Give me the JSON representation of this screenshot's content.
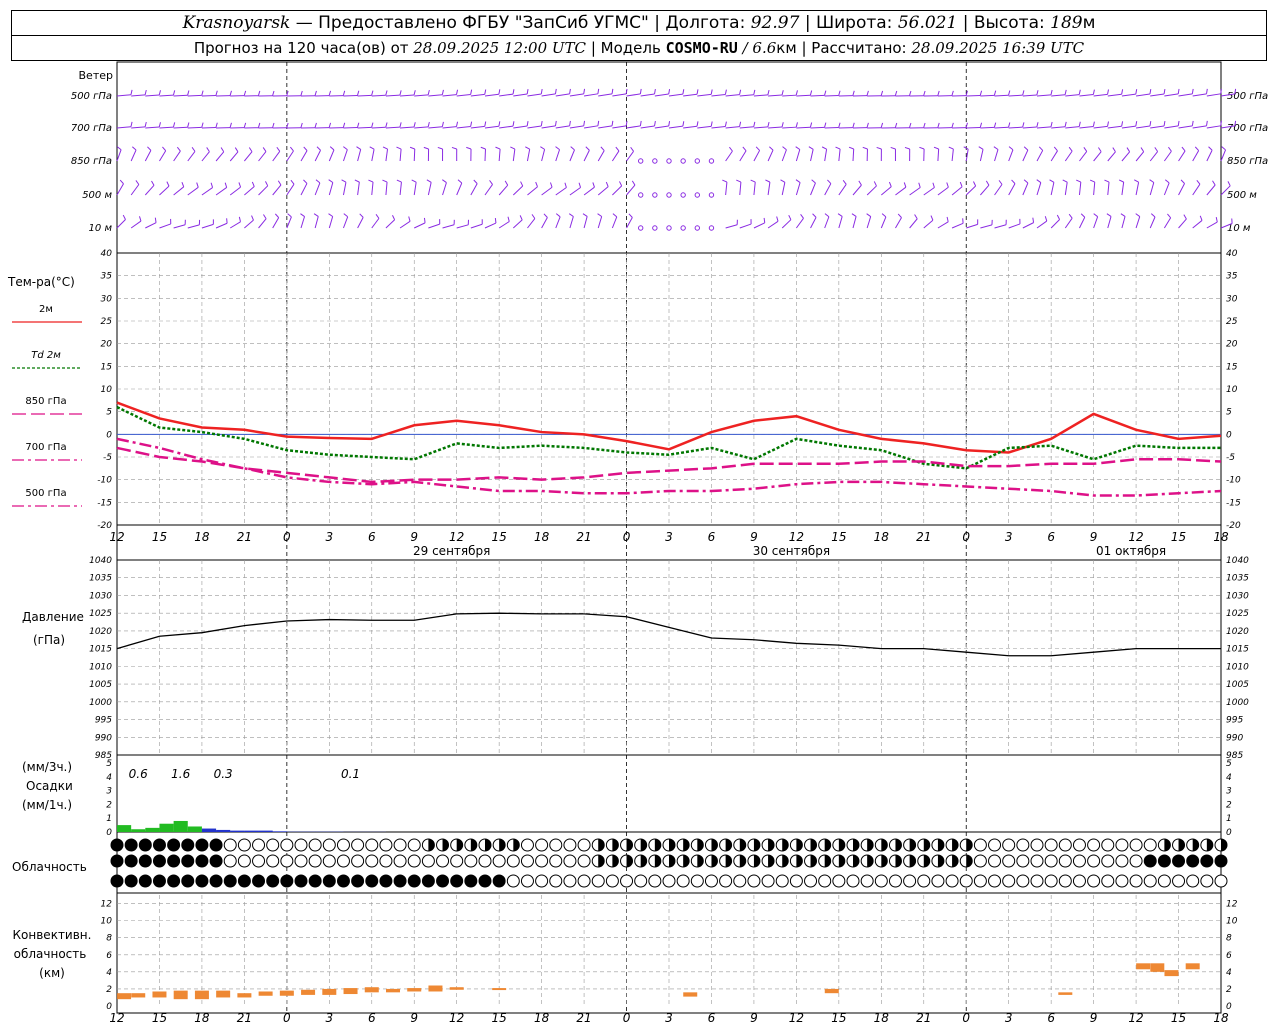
{
  "header": {
    "city": "Krasnoyarsk",
    "provider": "— Предоставлено ФГБУ \"ЗапСиб УГМС\" |",
    "lon_label": "Долгота:",
    "lon": "92.97",
    "lat_label": "| Широта:",
    "lat": "56.021",
    "alt_label": "| Высота:",
    "alt": "189",
    "alt_unit": "м",
    "forecast_prefix": "Прогноз на 120 часа(ов) от",
    "forecast_start": "28.09.2025 12:00 UTC",
    "model_label": "| Модель",
    "model": "COSMO-RU",
    "model_res": "/ 6.6",
    "model_res_unit": "км",
    "calc_label": "| Рассчитано:",
    "calc_time": "28.09.2025 16:39 UTC"
  },
  "chart_data": [
    {
      "type": "line",
      "panel": "wind",
      "title": "Ветер",
      "levels": [
        "500 гПа",
        "700 гПа",
        "850 гПа",
        "500 м",
        "10 м"
      ],
      "note": "wind barbs per level every hour"
    },
    {
      "type": "line",
      "panel": "temperature",
      "ylabel": "Тем-ра(°C)",
      "ylim": [
        -20,
        40
      ],
      "yticks": [
        40,
        35,
        30,
        25,
        20,
        15,
        10,
        5,
        0,
        -5,
        -10,
        -15,
        -20
      ],
      "x_hours": [
        0,
        3,
        6,
        9,
        12,
        15,
        18,
        21,
        24,
        27,
        30,
        33,
        36,
        39,
        42,
        45,
        48,
        51,
        54,
        57,
        60,
        63,
        66,
        69,
        72,
        75,
        78
      ],
      "series": [
        {
          "name": "2м",
          "color": "#ee2222",
          "values": [
            7,
            3.5,
            1.5,
            1,
            -0.5,
            -0.8,
            -1,
            2,
            3,
            2,
            0.5,
            0,
            -1.5,
            -3.3,
            0.5,
            3,
            4,
            1,
            -1,
            -2,
            -3.5,
            -4,
            -1,
            4.5,
            1,
            -1,
            -0.3
          ]
        },
        {
          "name": "Td 2м",
          "color": "#007700",
          "values": [
            6,
            1.5,
            0.5,
            -1,
            -3.5,
            -4.5,
            -5,
            -5.5,
            -2,
            -3,
            -2.5,
            -3,
            -4,
            -4.5,
            -3,
            -5.5,
            -1,
            -2.5,
            -3.5,
            -6.5,
            -7.5,
            -3,
            -2.5,
            -5.5,
            -2.5,
            -3,
            -3
          ]
        },
        {
          "name": "850 гПа",
          "color": "#dd1188",
          "values": [
            -3,
            -5,
            -6,
            -7.5,
            -8.5,
            -9.5,
            -10.5,
            -10,
            -10,
            -9.5,
            -10,
            -9.5,
            -8.5,
            -8,
            -7.5,
            -6.5,
            -6.5,
            -6.5,
            -6,
            -6,
            -7,
            -7,
            -6.5,
            -6.5,
            -5.5,
            -5.5,
            -6
          ]
        },
        {
          "name": "700 гПа",
          "color": "#dd1188",
          "values": [
            -1,
            -3,
            -5.5,
            -7.5,
            -9.5,
            -10.5,
            -11,
            -10.5,
            -11.5,
            -12.5,
            -12.5,
            -13,
            -13,
            -12.5,
            -12.5,
            -12,
            -11,
            -10.5,
            -10.5,
            -11,
            -11.5,
            -12,
            -12.5,
            -13.5,
            -13.5,
            -13,
            -12.5
          ]
        }
      ],
      "legend": [
        "2м",
        "Td 2м",
        "850 гПа",
        "700 гПа",
        "500 гПа"
      ],
      "grid": true
    },
    {
      "type": "line",
      "panel": "pressure",
      "ylabel": "Давление",
      "yunit": "(гПа)",
      "ylim": [
        985,
        1040
      ],
      "yticks": [
        1040,
        1035,
        1030,
        1025,
        1020,
        1015,
        1010,
        1005,
        1000,
        995,
        990,
        985
      ],
      "x_hours": [
        0,
        3,
        6,
        9,
        12,
        15,
        18,
        21,
        24,
        27,
        30,
        33,
        36,
        39,
        42,
        45,
        48,
        51,
        54,
        57,
        60,
        63,
        66,
        69,
        72,
        75,
        78
      ],
      "series": [
        {
          "name": "Давление",
          "color": "#000000",
          "values": [
            1015,
            1018.5,
            1019.5,
            1021.5,
            1022.8,
            1023.2,
            1023,
            1023,
            1024.8,
            1025,
            1024.8,
            1024.8,
            1024,
            1021,
            1018,
            1017.5,
            1016.5,
            1016,
            1015,
            1015,
            1014,
            1013,
            1013,
            1014,
            1015,
            1015,
            1015
          ]
        }
      ],
      "grid": true
    },
    {
      "type": "bar",
      "panel": "precipitation",
      "ylabel": "Осадки",
      "yunits": [
        "(мм/3ч.)",
        "(мм/1ч.)"
      ],
      "ylim": [
        0,
        5
      ],
      "yticks": [
        5,
        4,
        3,
        2,
        1,
        0
      ],
      "labels_3h": [
        {
          "hour": 1.5,
          "value": "0.6"
        },
        {
          "hour": 4.5,
          "value": "1.6"
        },
        {
          "hour": 7.5,
          "value": "0.3"
        },
        {
          "hour": 16.5,
          "value": "0.1"
        }
      ],
      "series": [
        {
          "name": "Осадки",
          "color": "#22bb22",
          "values": [
            0.5,
            0.2,
            0.3,
            0.6,
            0.8,
            0.4,
            0.25,
            0.15,
            0.1,
            0.1,
            0.1,
            0.05,
            0.02,
            0.02,
            0.02,
            0.02,
            0.01,
            0.01,
            0.01
          ]
        }
      ]
    },
    {
      "type": "table",
      "panel": "cloudiness",
      "title": "Облачность",
      "rows": 3,
      "note": "cloud cover circles per hour (filled = overcast, empty = clear)"
    },
    {
      "type": "bar",
      "panel": "convective",
      "ylabel": [
        "Конвективн.",
        "облачность",
        "(км)"
      ],
      "ylim": [
        0,
        13
      ],
      "yticks": [
        12,
        10,
        8,
        6,
        4,
        2,
        0
      ],
      "cloud_layers": [
        {
          "h": 0.5,
          "base": 0.8,
          "top": 1.5
        },
        {
          "h": 1.5,
          "base": 1.0,
          "top": 1.5
        },
        {
          "h": 3,
          "base": 1.0,
          "top": 1.7
        },
        {
          "h": 4.5,
          "base": 0.8,
          "top": 1.8
        },
        {
          "h": 6,
          "base": 0.8,
          "top": 1.8
        },
        {
          "h": 7.5,
          "base": 1.0,
          "top": 1.8
        },
        {
          "h": 9,
          "base": 1.0,
          "top": 1.5
        },
        {
          "h": 10.5,
          "base": 1.2,
          "top": 1.7
        },
        {
          "h": 12,
          "base": 1.2,
          "top": 1.8
        },
        {
          "h": 13.5,
          "base": 1.3,
          "top": 1.9
        },
        {
          "h": 15,
          "base": 1.3,
          "top": 2.0
        },
        {
          "h": 16.5,
          "base": 1.4,
          "top": 2.1
        },
        {
          "h": 18,
          "base": 1.6,
          "top": 2.2
        },
        {
          "h": 19.5,
          "base": 1.6,
          "top": 2.0
        },
        {
          "h": 21,
          "base": 1.7,
          "top": 2.1
        },
        {
          "h": 22.5,
          "base": 1.7,
          "top": 2.4
        },
        {
          "h": 24,
          "base": 1.9,
          "top": 2.2
        },
        {
          "h": 27,
          "base": 1.9,
          "top": 2.1
        },
        {
          "h": 40.5,
          "base": 1.1,
          "top": 1.6
        },
        {
          "h": 50.5,
          "base": 1.5,
          "top": 2.0
        },
        {
          "h": 67,
          "base": 1.3,
          "top": 1.6
        },
        {
          "h": 72.5,
          "base": 4.3,
          "top": 5.0
        },
        {
          "h": 73.5,
          "base": 4.0,
          "top": 5.0
        },
        {
          "h": 74.5,
          "base": 3.5,
          "top": 4.2
        },
        {
          "h": 76,
          "base": 4.3,
          "top": 5.0
        }
      ]
    }
  ],
  "axis": {
    "hour_labels": [
      "12",
      "15",
      "18",
      "21",
      "0",
      "3",
      "6",
      "9",
      "12",
      "15",
      "18",
      "21",
      "0",
      "3",
      "6",
      "9",
      "12",
      "15",
      "18",
      "21",
      "0",
      "3",
      "6",
      "9",
      "12",
      "15",
      "18"
    ],
    "dates": [
      "29 сентября",
      "30 сентября",
      "01 октября"
    ]
  }
}
